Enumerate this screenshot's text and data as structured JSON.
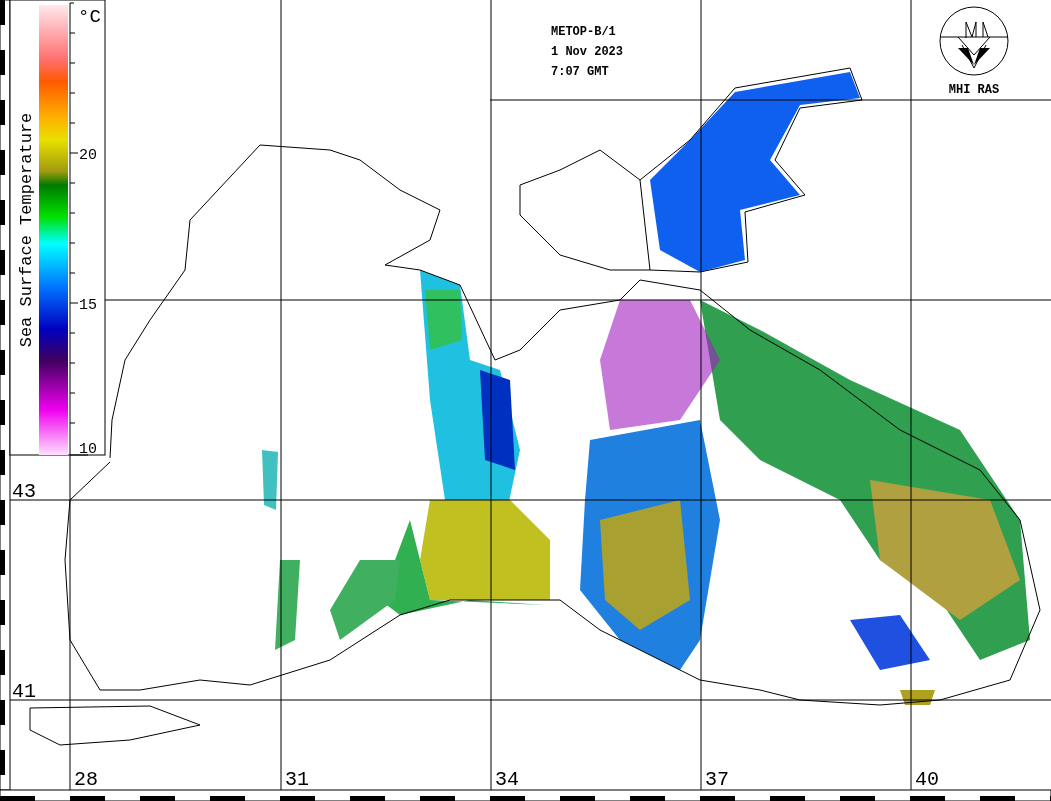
{
  "header": {
    "satellite": "METOP-B/1",
    "date": "1 Nov 2023",
    "time": "7:07 GMT"
  },
  "logo": {
    "label": "MHI RAS"
  },
  "legend": {
    "title": "Sea Surface Temperature",
    "unit": "°C",
    "ticks": [
      "20",
      "15",
      "10"
    ]
  },
  "map": {
    "longitude_labels": [
      "28",
      "31",
      "34",
      "37",
      "40"
    ],
    "latitude_labels": [
      "43",
      "41"
    ]
  }
}
